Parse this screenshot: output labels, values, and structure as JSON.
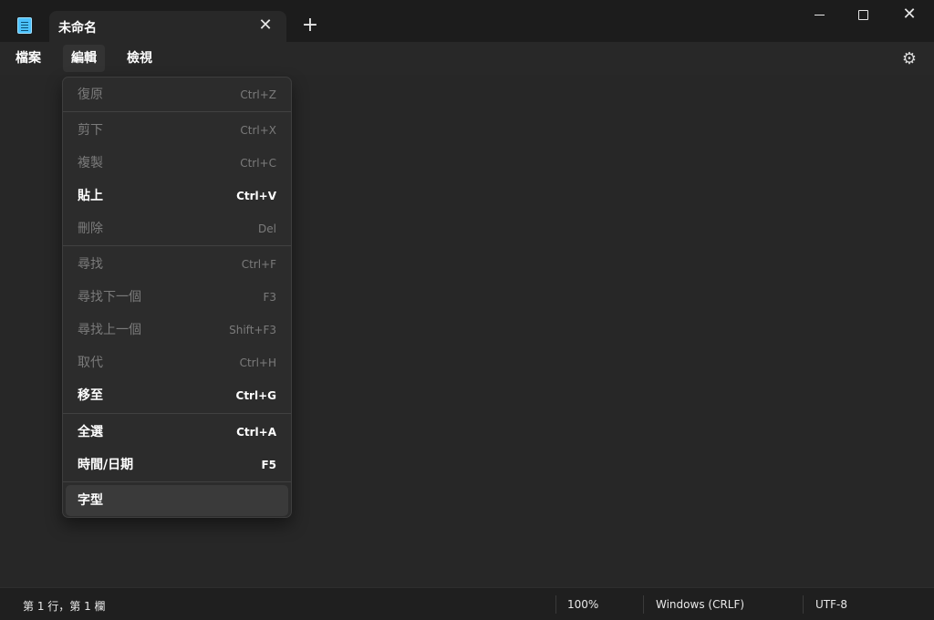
{
  "window": {
    "tab_title": "未命名",
    "close_tab_glyph": "✕",
    "new_tab_glyph": "+",
    "minimize_glyph": "",
    "maximize_glyph": "",
    "close_glyph": "✕",
    "settings_glyph": "⚙"
  },
  "menu": {
    "file": "檔案",
    "edit": "編輯",
    "view": "檢視"
  },
  "edit_menu": {
    "undo": {
      "label": "復原",
      "shortcut": "Ctrl+Z"
    },
    "cut": {
      "label": "剪下",
      "shortcut": "Ctrl+X"
    },
    "copy": {
      "label": "複製",
      "shortcut": "Ctrl+C"
    },
    "paste": {
      "label": "貼上",
      "shortcut": "Ctrl+V"
    },
    "delete": {
      "label": "刪除",
      "shortcut": "Del"
    },
    "find": {
      "label": "尋找",
      "shortcut": "Ctrl+F"
    },
    "find_next": {
      "label": "尋找下一個",
      "shortcut": "F3"
    },
    "find_previous": {
      "label": "尋找上一個",
      "shortcut": "Shift+F3"
    },
    "replace": {
      "label": "取代",
      "shortcut": "Ctrl+H"
    },
    "go_to": {
      "label": "移至",
      "shortcut": "Ctrl+G"
    },
    "select_all": {
      "label": "全選",
      "shortcut": "Ctrl+A"
    },
    "time_date": {
      "label": "時間/日期",
      "shortcut": "F5"
    },
    "font": {
      "label": "字型",
      "shortcut": ""
    }
  },
  "status": {
    "position": "第 1 行，第 1 欄",
    "zoom": "100%",
    "line_ending": "Windows (CRLF)",
    "encoding": "UTF-8"
  },
  "colors": {
    "accent": "#4cc2ff",
    "background": "#272727",
    "menu_surface": "#2c2c2c",
    "disabled_text": "#7b7b7b"
  }
}
